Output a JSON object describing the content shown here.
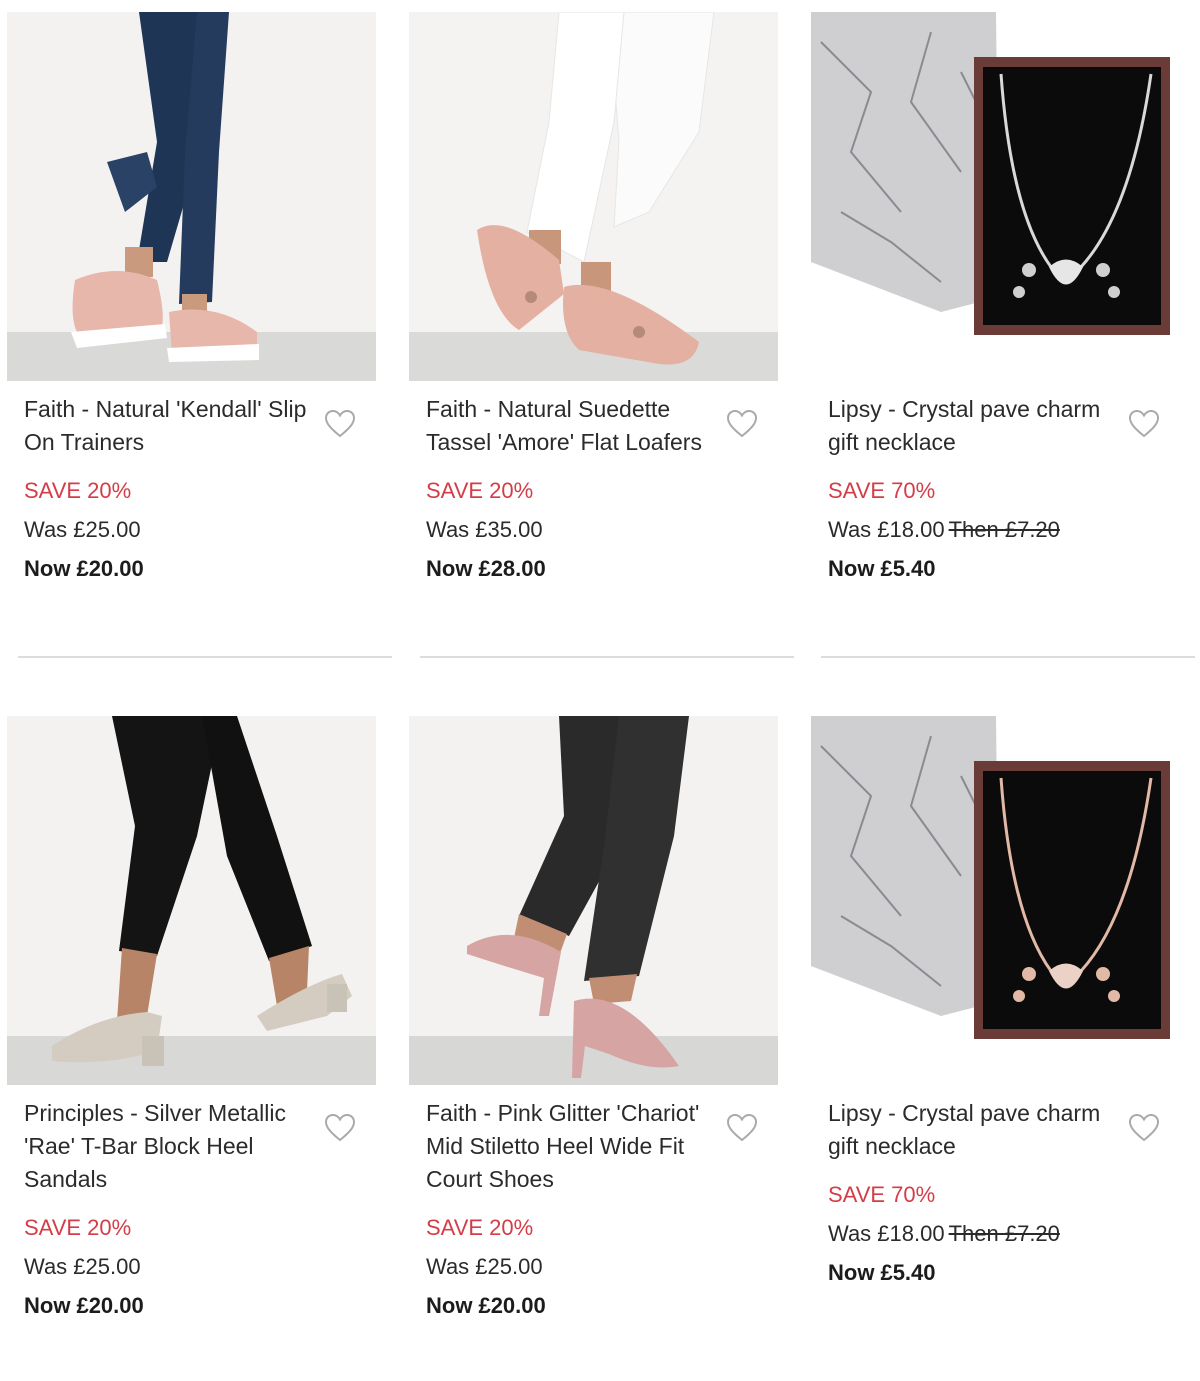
{
  "products": [
    {
      "title": "Faith - Natural 'Kendall' Slip On Trainers",
      "save": "SAVE 20%",
      "was": "Was £25.00",
      "then": "",
      "now_label": "Now",
      "now_price": "£20.00",
      "image": "pink-slip-on-trainers"
    },
    {
      "title": "Faith - Natural Suedette Tassel 'Amore' Flat Loafers",
      "save": "SAVE 20%",
      "was": "Was £35.00",
      "then": "",
      "now_label": "Now",
      "now_price": "£28.00",
      "image": "pink-tassel-loafers"
    },
    {
      "title": "Lipsy - Crystal pave charm gift necklace",
      "save": "SAVE 70%",
      "was": "Was £18.00",
      "then": "Then £7.20",
      "now_label": "Now",
      "now_price": "£5.40",
      "image": "silver-necklace-gift-box"
    },
    {
      "title": "Principles - Silver Metallic 'Rae' T-Bar Block Heel Sandals",
      "save": "SAVE 20%",
      "was": "Was £25.00",
      "then": "",
      "now_label": "Now",
      "now_price": "£20.00",
      "image": "silver-block-heel-sandals"
    },
    {
      "title": "Faith - Pink Glitter 'Chariot' Mid Stiletto Heel Wide Fit Court Shoes",
      "save": "SAVE 20%",
      "was": "Was £25.00",
      "then": "",
      "now_label": "Now",
      "now_price": "£20.00",
      "image": "pink-glitter-court-shoes"
    },
    {
      "title": "Lipsy - Crystal pave charm gift necklace",
      "save": "SAVE 70%",
      "was": "Was £18.00",
      "then": "Then £7.20",
      "now_label": "Now",
      "now_price": "£5.40",
      "image": "rose-gold-necklace-gift-box"
    }
  ],
  "icons": {
    "wishlist": "heart-outline-icon"
  },
  "colors": {
    "save": "#d43d47",
    "divider": "#dcdcdc",
    "heart": "#aaaaaa"
  }
}
